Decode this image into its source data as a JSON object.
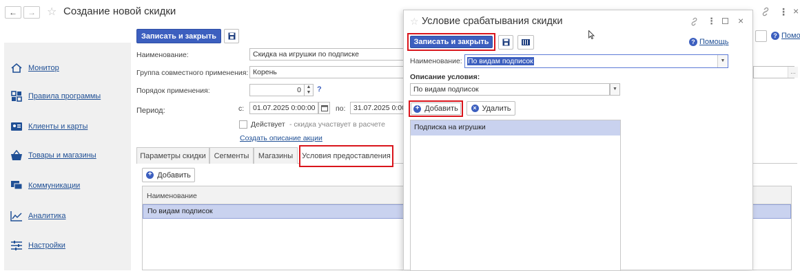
{
  "window": {
    "title": "Создание новой скидки"
  },
  "sidebar": {
    "items": [
      {
        "label": "Монитор",
        "icon": "home-icon"
      },
      {
        "label": "Правила программы",
        "icon": "grid-icon"
      },
      {
        "label": "Клиенты и карты",
        "icon": "id-card-icon"
      },
      {
        "label": "Товары и магазины",
        "icon": "basket-icon"
      },
      {
        "label": "Коммуникации",
        "icon": "chat-icon"
      },
      {
        "label": "Аналитика",
        "icon": "trend-icon"
      },
      {
        "label": "Настройки",
        "icon": "sliders-icon"
      }
    ]
  },
  "toolbar": {
    "save_close": "Записать и закрыть"
  },
  "help": {
    "label": "Помощь"
  },
  "form": {
    "name_label": "Наименование:",
    "name_value": "Скидка на игрушки по подписке",
    "group_label": "Группа совместного применения:",
    "group_value": "Корень",
    "order_label": "Порядок применения:",
    "order_value": "0",
    "order_help": "?",
    "period_label": "Период:",
    "from_label": "с:",
    "from_value": "01.07.2025  0:00:00",
    "to_label": "по:",
    "to_value": "31.07.2025  0:00",
    "active_label": "Действует",
    "active_hint": "- скидка участвует в расчете",
    "create_link": "Создать описание акции"
  },
  "tabs": [
    {
      "label": "Параметры скидки"
    },
    {
      "label": "Сегменты"
    },
    {
      "label": "Магазины"
    },
    {
      "label": "Условия предоставления",
      "active": true
    }
  ],
  "conditions": {
    "add_label": "Добавить",
    "column_header": "Наименование",
    "rows": [
      "По видам подписок"
    ]
  },
  "dialog": {
    "title": "Условие срабатывания скидки",
    "save_close": "Записать и закрыть",
    "help_label": "Помощь",
    "name_label": "Наименование:",
    "name_value": "По видам подписок",
    "desc_label": "Описание условия:",
    "desc_value": "По видам подписок",
    "add_label": "Добавить",
    "delete_label": "Удалить",
    "list_items": [
      "Подписка на игрушки"
    ]
  },
  "colors": {
    "accent": "#3c5fbf",
    "highlight": "#d9141b",
    "selection": "#c9d2ef",
    "link": "#1f4f95"
  }
}
